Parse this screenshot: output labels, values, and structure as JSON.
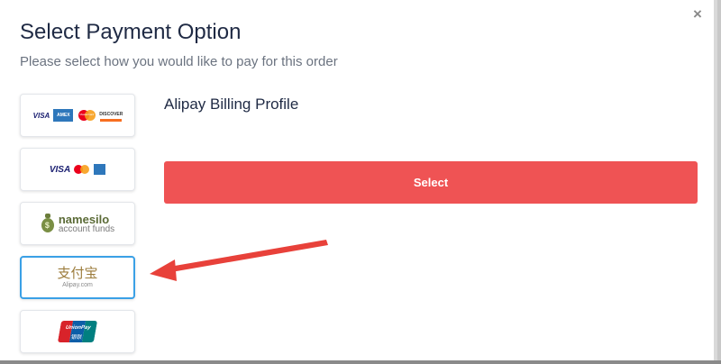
{
  "dialog": {
    "title": "Select Payment Option",
    "subtitle": "Please select how you would like to pay for this order",
    "close_glyph": "×"
  },
  "methods": [
    {
      "name": "cards-multi",
      "labels": [
        "VISA",
        "AMEX",
        "MasterCard",
        "DISCOVER"
      ]
    },
    {
      "name": "cards-basic",
      "labels": [
        "VISA"
      ]
    },
    {
      "name": "namesilo-funds",
      "labels": [
        "namesilo",
        "account funds"
      ]
    },
    {
      "name": "alipay",
      "labels": [
        "支付宝",
        "Alipay.com"
      ],
      "selected": true
    },
    {
      "name": "unionpay",
      "labels": [
        "UnionPay",
        "银联"
      ]
    }
  ],
  "main": {
    "profile_title": "Alipay Billing Profile",
    "select_label": "Select"
  },
  "colors": {
    "accent": "#ef5354",
    "selected_border": "#3aa0e6",
    "title": "#1f2a44",
    "arrow": "#e8413a"
  }
}
